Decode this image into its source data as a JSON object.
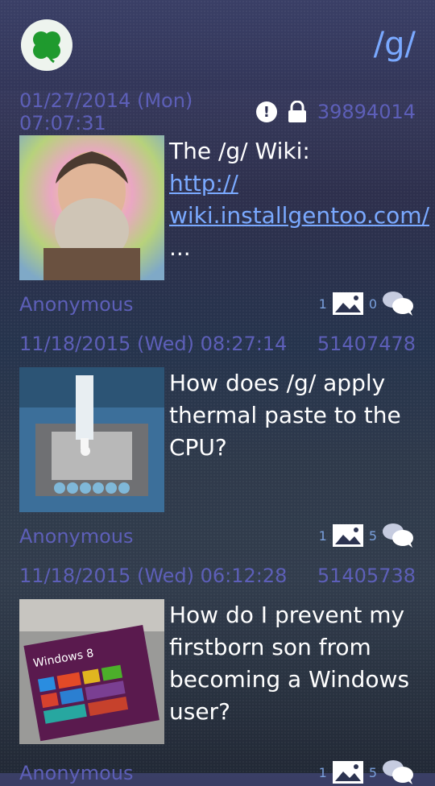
{
  "header": {
    "board_name": "/g/",
    "logo_icon": "clover-icon"
  },
  "threads": [
    {
      "date": "01/27/2014 (Mon) 07:07:31",
      "id": "39894014",
      "sticky": true,
      "locked": true,
      "subject_text": "The /g/ Wiki:",
      "link_line1": "http://",
      "link_line2": "wiki.installgentoo.com/",
      "trailing": "...",
      "author": "Anonymous",
      "image_count": "1",
      "reply_count": "0"
    },
    {
      "date": "11/18/2015 (Wed) 08:27:14",
      "id": "51407478",
      "subject_text": "How does /g/ apply thermal paste to the CPU?",
      "author": "Anonymous",
      "image_count": "1",
      "reply_count": "5"
    },
    {
      "date": "11/18/2015 (Wed) 06:12:28",
      "id": "51405738",
      "subject_text": "How do I prevent my firstborn son from becoming a Windows user?",
      "author": "Anonymous",
      "image_count": "1",
      "reply_count": "5",
      "thumb_label": "Windows 8"
    }
  ]
}
